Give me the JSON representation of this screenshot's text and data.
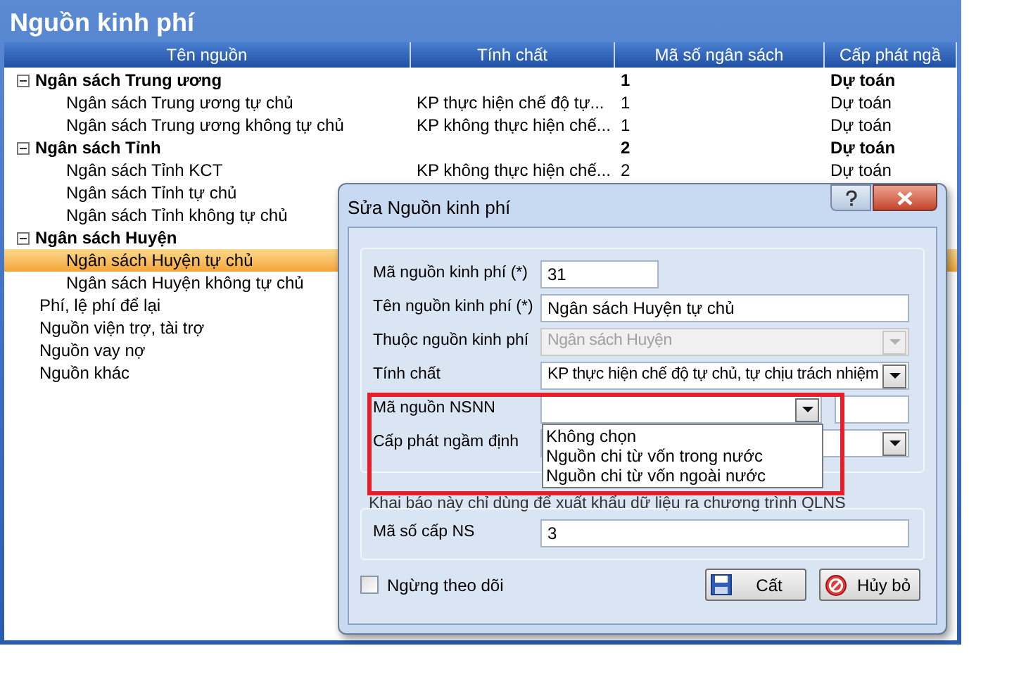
{
  "window": {
    "title": "Nguồn kinh phí"
  },
  "table": {
    "columns": [
      "Tên nguồn",
      "Tính chất",
      "Mã số ngân sách",
      "Cấp phát ngầ"
    ],
    "rows": [
      {
        "name": "Ngân sách Trung ương",
        "code": "1",
        "allocation": "Dự toán",
        "expanded": true,
        "selected": false,
        "children": [
          {
            "name": "Ngân sách Trung ương tự chủ",
            "property": "KP thực hiện chế độ tự...",
            "code": "1",
            "allocation": "Dự toán",
            "selected": false
          },
          {
            "name": "Ngân sách Trung ương không tự chủ",
            "property": "KP không thực hiện chế...",
            "code": "1",
            "allocation": "Dự toán",
            "selected": false
          }
        ]
      },
      {
        "name": "Ngân sách Tỉnh",
        "code": "2",
        "allocation": "Dự toán",
        "expanded": true,
        "selected": false,
        "children": [
          {
            "name": "Ngân sách Tỉnh KCT",
            "property": "KP không thực hiện chế...",
            "code": "2",
            "allocation": "Dự toán",
            "selected": false
          },
          {
            "name": "Ngân sách Tỉnh tự chủ",
            "selected": false
          },
          {
            "name": "Ngân sách Tỉnh không tự chủ",
            "selected": false
          }
        ]
      },
      {
        "name": "Ngân sách Huyện",
        "expanded": true,
        "selected": false,
        "children": [
          {
            "name": "Ngân sách Huyện tự chủ",
            "selected": true
          },
          {
            "name": "Ngân sách Huyện không tự chủ",
            "selected": false
          }
        ]
      },
      {
        "name": "Phí, lệ phí để lại",
        "selected": false
      },
      {
        "name": "Nguồn viện trợ, tài trợ",
        "selected": false
      },
      {
        "name": "Nguồn vay nợ",
        "selected": false
      },
      {
        "name": "Nguồn khác",
        "selected": false
      }
    ]
  },
  "dialog": {
    "title": "Sửa Nguồn kinh phí",
    "fields": [
      {
        "kind": "short",
        "label": "Mã nguồn kinh phí (*)",
        "value": "31",
        "disabled": false
      },
      {
        "kind": "text",
        "label": "Tên nguồn kinh phí (*)",
        "value": "Ngân sách Huyện tự chủ",
        "disabled": false
      },
      {
        "kind": "combo",
        "label": "Thuộc nguồn kinh phí",
        "value": "Ngân sách Huyện",
        "disabled": true
      },
      {
        "kind": "combo",
        "label": "Tính chất",
        "value": "KP thực hiện chế độ tự chủ, tự chịu trách nhiệm",
        "disabled": false
      },
      {
        "kind": "combo_extra",
        "label": "Mã nguồn NSNN",
        "disabled": false,
        "open": true,
        "options": [
          {
            "label": "Không chọn",
            "selected": false
          },
          {
            "label": "Nguồn chi từ vốn trong nước",
            "selected": false
          },
          {
            "label": "Nguồn chi từ vốn ngoài nước",
            "selected": false
          }
        ]
      },
      {
        "kind": "combo",
        "label": "Cấp phát ngầm định",
        "disabled": false
      }
    ],
    "note": "Khai báo này chỉ dùng để xuất khẩu dữ liệu ra chương trình QLNS",
    "budget_level": {
      "label": "Mã số cấp NS",
      "value": "3"
    },
    "stop_tracking": {
      "label": "Ngừng theo dõi",
      "checked": false
    },
    "buttons": [
      {
        "kind": "save",
        "label": "Cất"
      },
      {
        "kind": "cancel",
        "label": "Hủy bỏ"
      }
    ]
  }
}
